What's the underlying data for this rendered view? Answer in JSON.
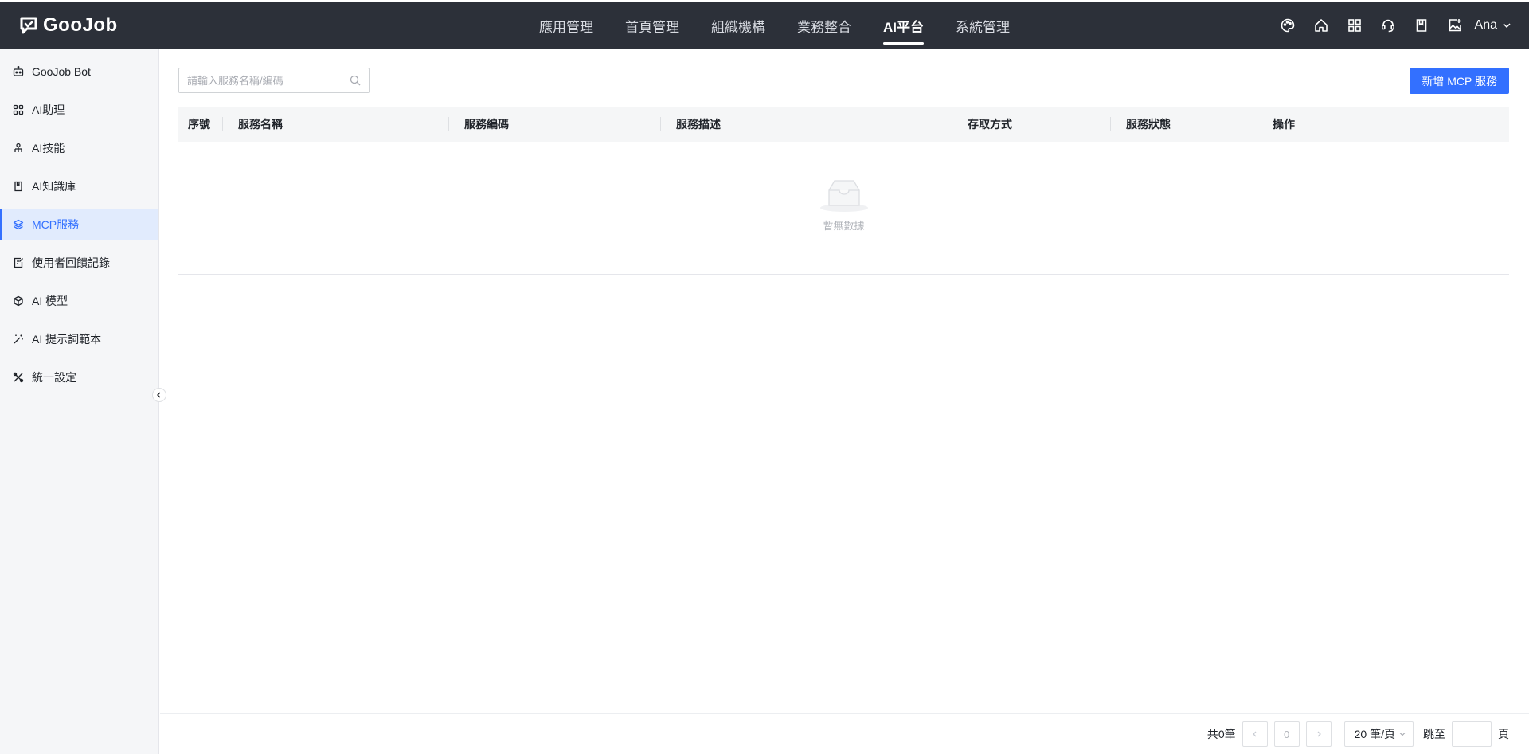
{
  "app": {
    "logo_text": "GooJob"
  },
  "topnav": {
    "items": [
      {
        "label": "應用管理"
      },
      {
        "label": "首頁管理"
      },
      {
        "label": "組織機構"
      },
      {
        "label": "業務整合"
      },
      {
        "label": "AI平台",
        "active": true
      },
      {
        "label": "系統管理"
      }
    ],
    "icons": [
      "palette-icon",
      "home-icon",
      "apps-grid-icon",
      "support-icon",
      "book-icon",
      "add-image-icon"
    ],
    "user_name": "Ana"
  },
  "sidebar": {
    "items": [
      {
        "label": "GooJob Bot",
        "icon": "robot-icon"
      },
      {
        "label": "AI助理",
        "icon": "grid-icon"
      },
      {
        "label": "AI技能",
        "icon": "skill-icon"
      },
      {
        "label": "AI知識庫",
        "icon": "notebook-icon"
      },
      {
        "label": "MCP服務",
        "icon": "layers-icon",
        "active": true
      },
      {
        "label": "使用者回饋記錄",
        "icon": "edit-note-icon"
      },
      {
        "label": "AI 模型",
        "icon": "cube-icon"
      },
      {
        "label": "AI 提示詞範本",
        "icon": "magic-wand-icon"
      },
      {
        "label": "統一設定",
        "icon": "tools-icon"
      }
    ]
  },
  "search": {
    "placeholder": "請輸入服務名稱/編碼"
  },
  "toolbar": {
    "add_label": "新增 MCP 服務"
  },
  "table": {
    "columns": [
      "序號",
      "服務名稱",
      "服務編碼",
      "服務描述",
      "存取方式",
      "服務狀態",
      "操作"
    ],
    "rows": [],
    "empty_text": "暫無數據"
  },
  "pagination": {
    "total_text": "共0筆",
    "current_page": "0",
    "page_size": "20 筆/頁",
    "jump_label": "跳至",
    "page_suffix": "頁"
  },
  "colors": {
    "topbar": "#2c3039",
    "accent": "#3370ff",
    "sidebar_bg": "#f5f6f8",
    "sidebar_active_bg": "#e1ebfd"
  }
}
